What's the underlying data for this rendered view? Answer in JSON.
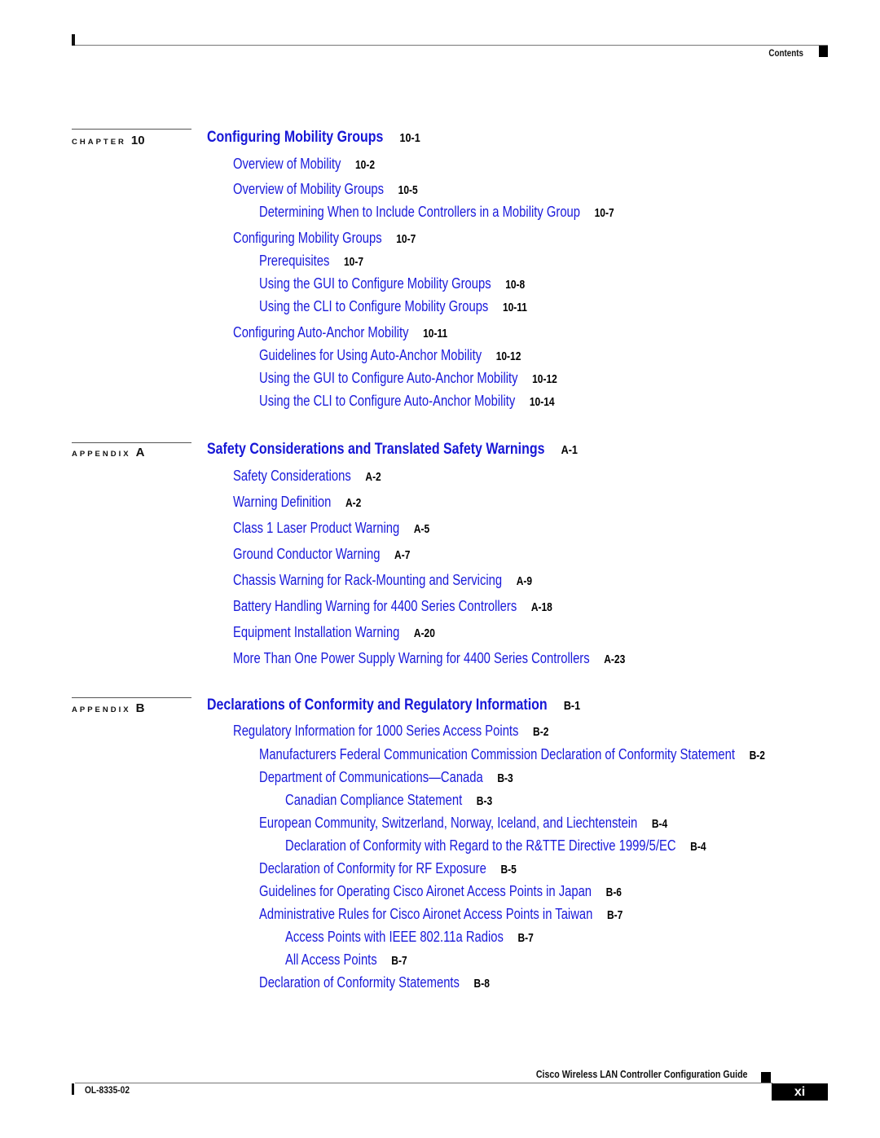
{
  "header": {
    "section_label": "Contents"
  },
  "sections": [
    {
      "kind": "CHAPTER",
      "number": "10",
      "title": "Configuring Mobility Groups",
      "page": "10-1",
      "entries": [
        {
          "level": 1,
          "text": "Overview of Mobility",
          "page": "10-2"
        },
        {
          "level": 1,
          "text": "Overview of Mobility Groups",
          "page": "10-5"
        },
        {
          "level": 2,
          "text": "Determining When to Include Controllers in a Mobility Group",
          "page": "10-7"
        },
        {
          "level": 1,
          "text": "Configuring Mobility Groups",
          "page": "10-7"
        },
        {
          "level": 2,
          "text": "Prerequisites",
          "page": "10-7"
        },
        {
          "level": 2,
          "text": "Using the GUI to Configure Mobility Groups",
          "page": "10-8"
        },
        {
          "level": 2,
          "text": "Using the CLI to Configure Mobility Groups",
          "page": "10-11"
        },
        {
          "level": 1,
          "text": "Configuring Auto-Anchor Mobility",
          "page": "10-11"
        },
        {
          "level": 2,
          "text": "Guidelines for Using Auto-Anchor Mobility",
          "page": "10-12"
        },
        {
          "level": 2,
          "text": "Using the GUI to Configure Auto-Anchor Mobility",
          "page": "10-12"
        },
        {
          "level": 2,
          "text": "Using the CLI to Configure Auto-Anchor Mobility",
          "page": "10-14"
        }
      ]
    },
    {
      "kind": "APPENDIX",
      "number": "A",
      "title": "Safety Considerations and Translated Safety Warnings",
      "page": "A-1",
      "entries": [
        {
          "level": 1,
          "text": "Safety Considerations",
          "page": "A-2"
        },
        {
          "level": 1,
          "text": "Warning Definition",
          "page": "A-2"
        },
        {
          "level": 1,
          "text": "Class 1 Laser Product Warning",
          "page": "A-5"
        },
        {
          "level": 1,
          "text": "Ground Conductor Warning",
          "page": "A-7"
        },
        {
          "level": 1,
          "text": "Chassis Warning for Rack-Mounting and Servicing",
          "page": "A-9"
        },
        {
          "level": 1,
          "text": "Battery Handling Warning for 4400 Series Controllers",
          "page": "A-18"
        },
        {
          "level": 1,
          "text": "Equipment Installation Warning",
          "page": "A-20"
        },
        {
          "level": 1,
          "text": "More Than One Power Supply Warning for 4400 Series Controllers",
          "page": "A-23"
        }
      ]
    },
    {
      "kind": "APPENDIX",
      "number": "B",
      "title": "Declarations of Conformity and Regulatory Information",
      "page": "B-1",
      "entries": [
        {
          "level": 1,
          "text": "Regulatory Information for 1000 Series Access Points",
          "page": "B-2"
        },
        {
          "level": 2,
          "text": "Manufacturers Federal Communication Commission Declaration of Conformity Statement",
          "page": "B-2"
        },
        {
          "level": 2,
          "text": "Department of Communications—Canada",
          "page": "B-3"
        },
        {
          "level": 3,
          "text": "Canadian Compliance Statement",
          "page": "B-3"
        },
        {
          "level": 2,
          "text": "European Community, Switzerland, Norway, Iceland, and Liechtenstein",
          "page": "B-4"
        },
        {
          "level": 3,
          "text": "Declaration of Conformity with Regard to the R&TTE Directive 1999/5/EC",
          "page": "B-4"
        },
        {
          "level": 2,
          "text": "Declaration of Conformity for RF Exposure",
          "page": "B-5"
        },
        {
          "level": 2,
          "text": "Guidelines for Operating Cisco Aironet Access Points in Japan",
          "page": "B-6"
        },
        {
          "level": 2,
          "text": "Administrative Rules for Cisco Aironet Access Points in Taiwan",
          "page": "B-7"
        },
        {
          "level": 3,
          "text": "Access Points with IEEE 802.11a Radios",
          "page": "B-7"
        },
        {
          "level": 3,
          "text": "All Access Points",
          "page": "B-7"
        },
        {
          "level": 2,
          "text": "Declaration of Conformity Statements",
          "page": "B-8"
        }
      ]
    }
  ],
  "footer": {
    "guide_title": "Cisco Wireless LAN Controller Configuration Guide",
    "doc_number": "OL-8335-02",
    "page_number": "xi"
  },
  "colors": {
    "link": "#1a1adb",
    "text": "#000000"
  }
}
